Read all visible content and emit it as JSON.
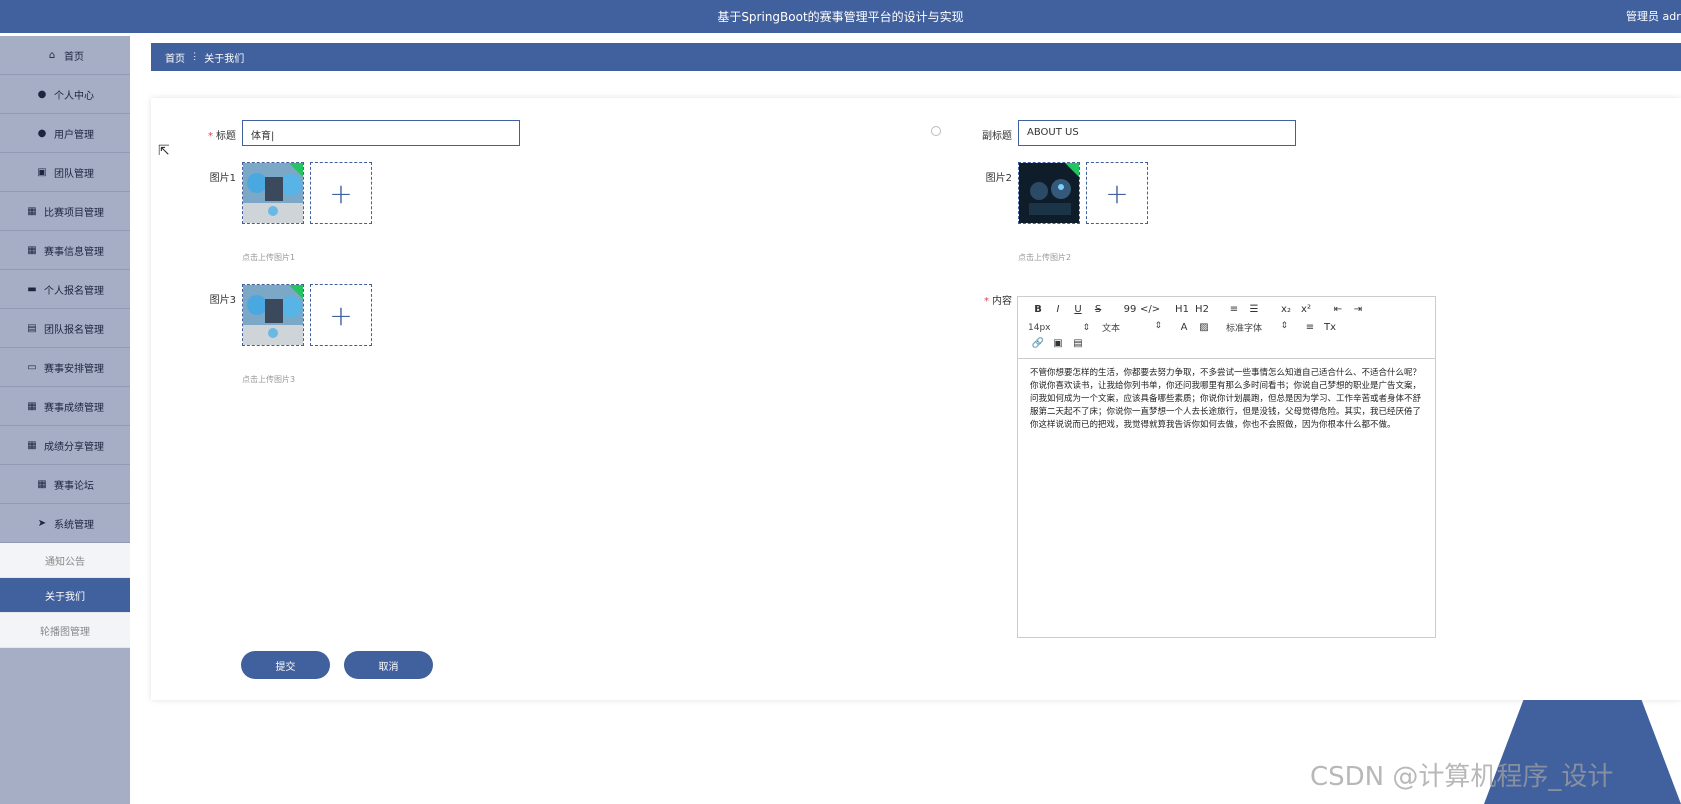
{
  "header": {
    "title": "基于SpringBoot的赛事管理平台的设计与实现",
    "user": "管理员 adr"
  },
  "sidebar": {
    "items": [
      {
        "label": "首页",
        "icon": "home-icon"
      },
      {
        "label": "个人中心",
        "icon": "user-icon"
      },
      {
        "label": "用户管理",
        "icon": "user-icon"
      },
      {
        "label": "团队管理",
        "icon": "chart-icon"
      },
      {
        "label": "比赛项目管理",
        "icon": "grid-icon"
      },
      {
        "label": "赛事信息管理",
        "icon": "grid-icon"
      },
      {
        "label": "个人报名管理",
        "icon": "message-icon"
      },
      {
        "label": "团队报名管理",
        "icon": "clipboard-icon"
      },
      {
        "label": "赛事安排管理",
        "icon": "monitor-icon"
      },
      {
        "label": "赛事成绩管理",
        "icon": "grid-icon"
      },
      {
        "label": "成绩分享管理",
        "icon": "grid-icon"
      },
      {
        "label": "赛事论坛",
        "icon": "grid-icon"
      },
      {
        "label": "系统管理",
        "icon": "send-icon"
      }
    ],
    "subitems": [
      {
        "label": "通知公告",
        "active": false
      },
      {
        "label": "关于我们",
        "active": true
      },
      {
        "label": "轮播图管理",
        "active": false
      }
    ]
  },
  "breadcrumb": {
    "home": "首页",
    "separator": "ⵗ",
    "current": "关于我们"
  },
  "form": {
    "title_label": "标题",
    "title_value": "体育|",
    "subtitle_label": "副标题",
    "subtitle_value": "ABOUT US",
    "image1_label": "图片1",
    "image1_hint": "点击上传图片1",
    "image2_label": "图片2",
    "image2_hint": "点击上传图片2",
    "image3_label": "图片3",
    "image3_hint": "点击上传图片3",
    "content_label": "内容",
    "required_mark": "*",
    "upload_plus": "+"
  },
  "editor": {
    "toolbar_row1": [
      "B",
      "I",
      "U",
      "S",
      "99",
      "</>",
      "H1",
      "H2",
      "≡",
      "☰",
      "x₂",
      "x²",
      "⇤",
      "⇥"
    ],
    "font_size": "14px",
    "text_style": "文本",
    "font_family": "标准字体",
    "content": "不管你想要怎样的生活，你都要去努力争取，不多尝试一些事情怎么知道自己适合什么、不适合什么呢？你说你喜欢读书，让我给你列书单，你还问我哪里有那么多时间看书；你说自己梦想的职业是广告文案，问我如何成为一个文案，应该具备哪些素质；你说你计划晨跑，但总是因为学习、工作辛苦或者身体不舒服第二天起不了床；你说你一直梦想一个人去长途旅行，但是没钱，父母觉得危险。其实，我已经厌倦了你这样说说而已的把戏，我觉得就算我告诉你如何去做，你也不会照做，因为你根本什么都不做。"
  },
  "buttons": {
    "submit": "提交",
    "cancel": "取消"
  },
  "watermark": "CSDN @计算机程序_设计",
  "colors": {
    "primary": "#41609e",
    "sidebar_bg": "#a6aec5",
    "required": "#e04545"
  }
}
